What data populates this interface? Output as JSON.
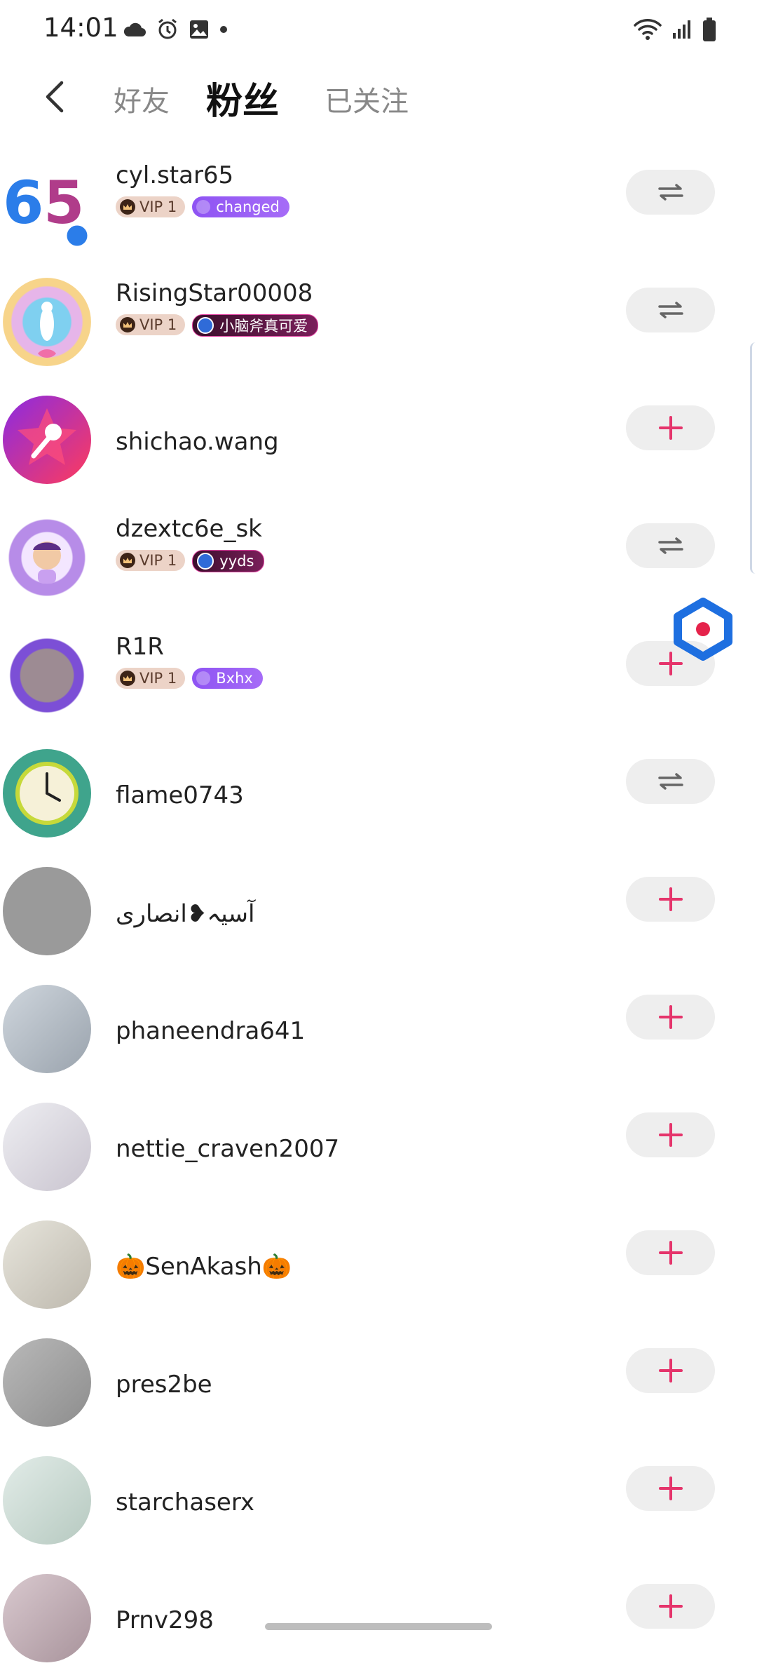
{
  "status_bar": {
    "time": "14:01"
  },
  "header": {
    "tabs": [
      {
        "label": "好友",
        "active": false
      },
      {
        "label": "粉丝",
        "active": true
      },
      {
        "label": "已关注",
        "active": false
      }
    ]
  },
  "colors": {
    "accent": "#e5346b",
    "button_bg": "#eeeeee",
    "vip_bg": "#ecd3c7"
  },
  "rows": [
    {
      "name": "cyl.star65",
      "vip": "VIP 1",
      "fan_label": "changed",
      "fan_style": "purple",
      "action": "mutual-icon"
    },
    {
      "name": "RisingStar00008",
      "vip": "VIP 1",
      "fan_label": "小脑斧真可爱",
      "fan_style": "dark",
      "action": "mutual-icon"
    },
    {
      "name": "shichao.wang",
      "action": "plus-icon"
    },
    {
      "name": "dzextc6e_sk",
      "vip": "VIP 1",
      "fan_label": "yyds",
      "fan_style": "dark",
      "action": "mutual-icon"
    },
    {
      "name": "R1R",
      "vip": "VIP 1",
      "fan_label": "Bxhx",
      "fan_style": "purple",
      "action": "plus-icon"
    },
    {
      "name": "flame0743",
      "action": "mutual-icon"
    },
    {
      "name": "آسیہ❥انصاری",
      "action": "plus-icon"
    },
    {
      "name": "phaneendra641",
      "action": "plus-icon"
    },
    {
      "name": "nettie_craven2007",
      "action": "plus-icon"
    },
    {
      "name": "🎃SenAkash🎃",
      "action": "plus-icon"
    },
    {
      "name": "pres2be",
      "action": "plus-icon"
    },
    {
      "name": "starchaserx",
      "action": "plus-icon"
    },
    {
      "name": "Prnv298",
      "action": "plus-icon"
    }
  ]
}
